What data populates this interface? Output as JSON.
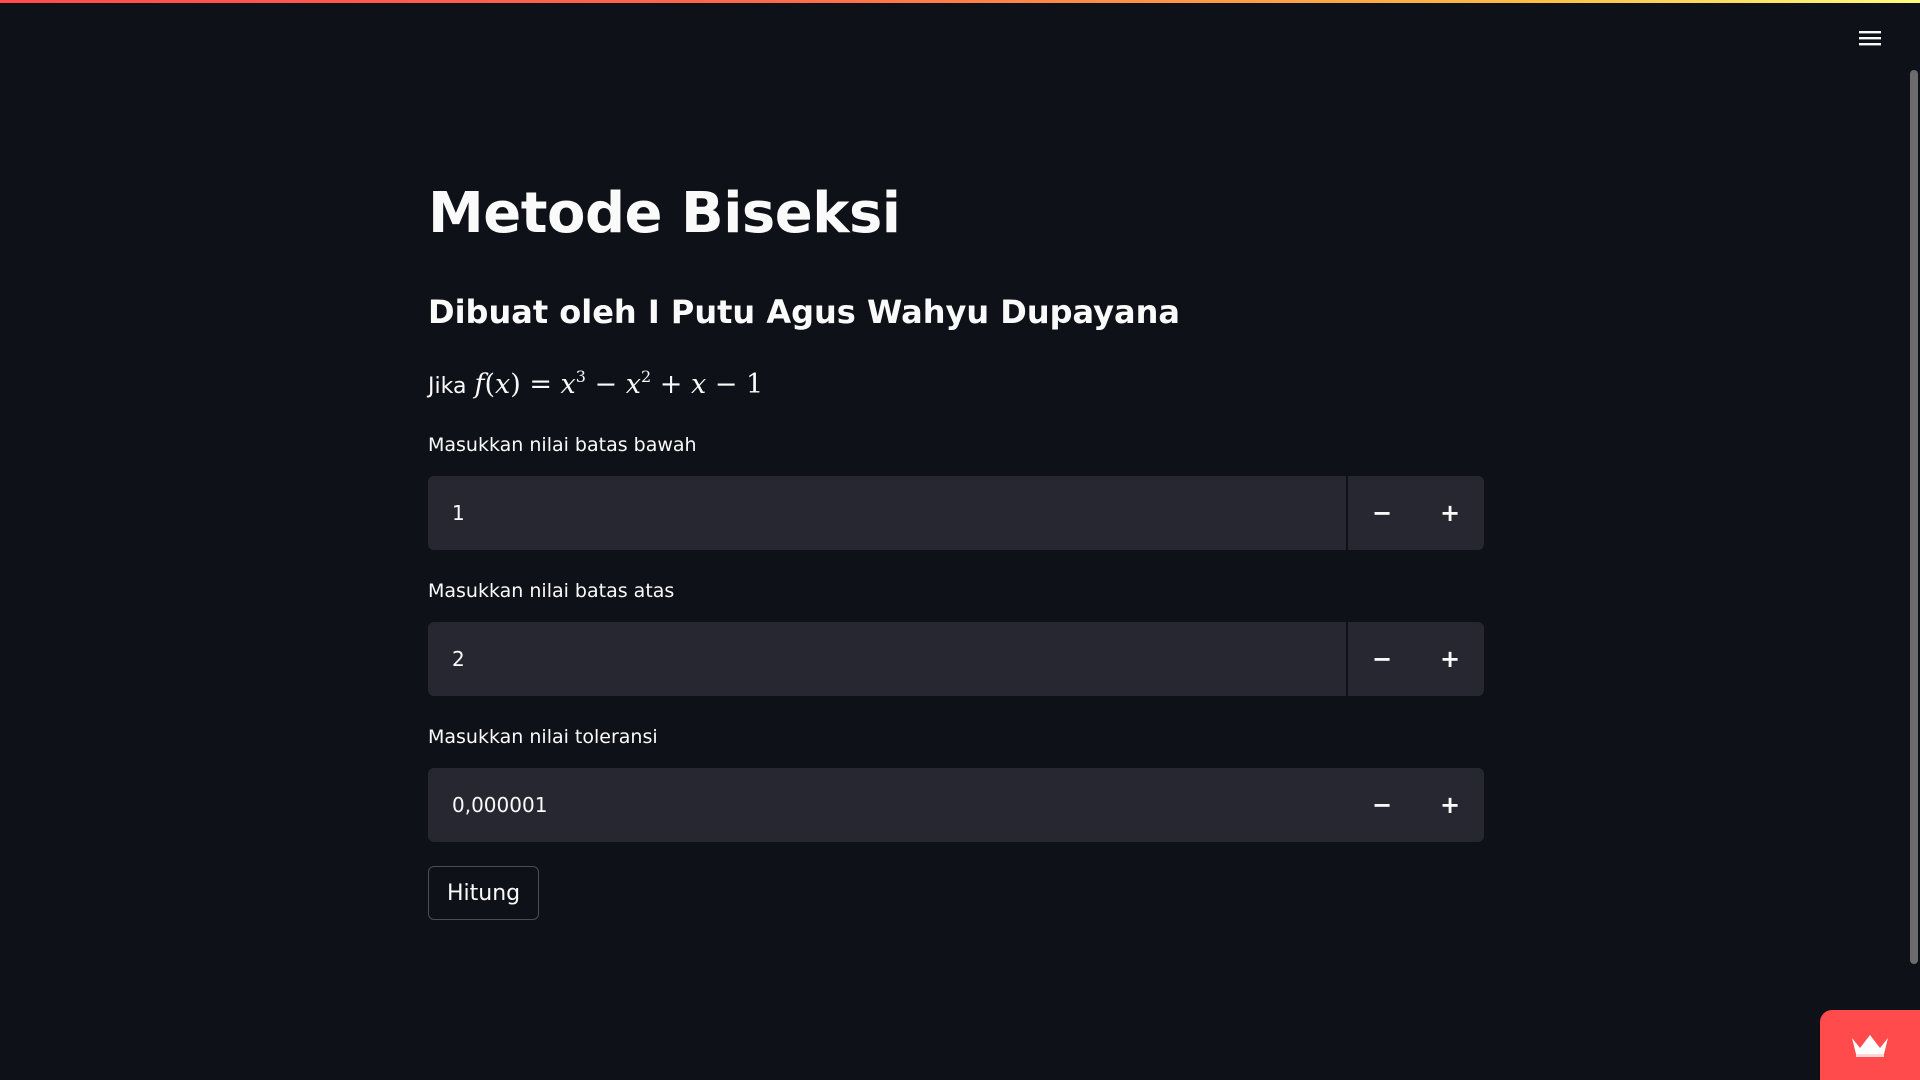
{
  "app": {
    "title": "Metode Biseksi",
    "subtitle": "Dibuat oleh I Putu Agus Wahyu Dupayana",
    "formula_prefix": "Jika",
    "formula": "f(x) = x^3 - x^2 + x - 1"
  },
  "fields": [
    {
      "label": "Masukkan nilai batas bawah",
      "value": "1"
    },
    {
      "label": "Masukkan nilai batas atas",
      "value": "2"
    },
    {
      "label": "Masukkan nilai toleransi",
      "value": "0,000001"
    }
  ],
  "stepper": {
    "minus": "−",
    "plus": "+"
  },
  "button": {
    "label": "Hitung"
  },
  "icons": {
    "menu": "hamburger-menu-icon",
    "badge": "crown-icon"
  },
  "colors": {
    "background": "#0e1117",
    "input_bg": "#262730",
    "accent": "#ff4b4b"
  }
}
